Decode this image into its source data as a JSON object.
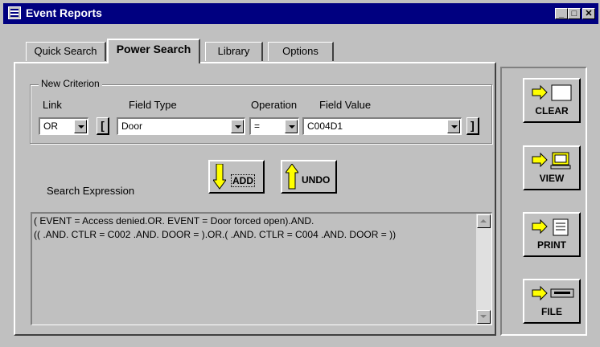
{
  "window": {
    "title": "Event Reports",
    "minimize": "_",
    "maximize": "□",
    "close": "✕"
  },
  "tabs": [
    {
      "label": "Quick Search",
      "active": false
    },
    {
      "label": "Power Search",
      "active": true
    },
    {
      "label": "Library",
      "active": false
    },
    {
      "label": "Options",
      "active": false
    }
  ],
  "criterion": {
    "group_label": "New Criterion",
    "link_label": "Link",
    "field_type_label": "Field Type",
    "operation_label": "Operation",
    "field_value_label": "Field Value",
    "link_value": "OR",
    "open_bracket": "[",
    "field_type_value": "Door",
    "operation_value": "=",
    "field_value_value": "C004D1",
    "close_bracket": "]"
  },
  "expression": {
    "label": "Search Expression",
    "add_label": "ADD",
    "undo_label": "UNDO",
    "lines": [
      "( EVENT = Access denied.OR. EVENT = Door forced open).AND.",
      "(( .AND. CTLR = C002 .AND. DOOR = ).OR.( .AND. CTLR = C004 .AND. DOOR = ))"
    ]
  },
  "side_buttons": {
    "clear": "CLEAR",
    "view": "VIEW",
    "print": "PRINT",
    "file": "FILE"
  },
  "colors": {
    "titlebar": "#000080",
    "face": "#c0c0c0",
    "arrow": "#ffff00"
  }
}
